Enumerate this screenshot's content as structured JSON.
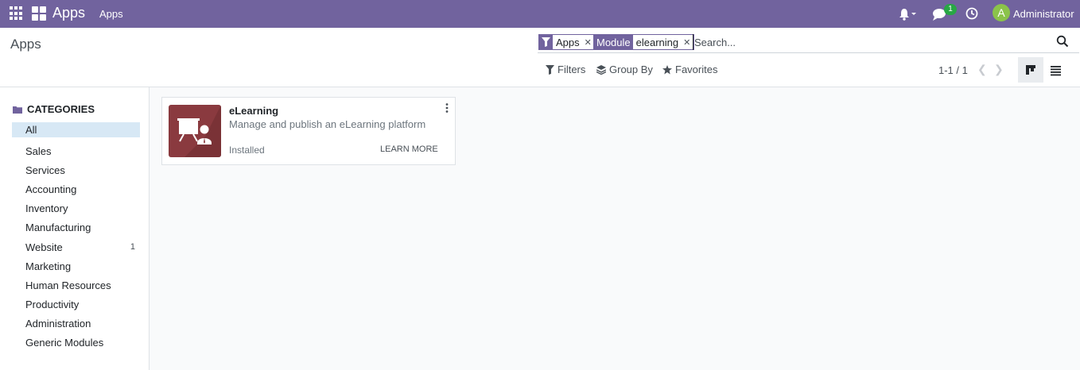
{
  "navbar": {
    "brand": "Apps",
    "menu": [
      "Apps"
    ],
    "chat_badge": "1",
    "avatar_letter": "A",
    "username": "Administrator"
  },
  "control_panel": {
    "breadcrumb": "Apps",
    "facets": [
      {
        "icon": "filter-icon",
        "label": "",
        "value": "Apps"
      },
      {
        "icon": "",
        "label": "Module",
        "value": "elearning"
      }
    ],
    "search_placeholder": "Search...",
    "filters_label": "Filters",
    "group_by_label": "Group By",
    "favorites_label": "Favorites",
    "pager": "1-1 / 1",
    "active_view": "kanban"
  },
  "sidebar": {
    "header": "CATEGORIES",
    "items": [
      {
        "label": "All",
        "count": "",
        "active": true
      },
      {
        "label": "Sales",
        "count": ""
      },
      {
        "label": "Services",
        "count": ""
      },
      {
        "label": "Accounting",
        "count": ""
      },
      {
        "label": "Inventory",
        "count": ""
      },
      {
        "label": "Manufacturing",
        "count": ""
      },
      {
        "label": "Website",
        "count": "1"
      },
      {
        "label": "Marketing",
        "count": ""
      },
      {
        "label": "Human Resources",
        "count": ""
      },
      {
        "label": "Productivity",
        "count": ""
      },
      {
        "label": "Administration",
        "count": ""
      },
      {
        "label": "Generic Modules",
        "count": ""
      }
    ]
  },
  "cards": [
    {
      "title": "eLearning",
      "description": "Manage and publish an eLearning platform",
      "status": "Installed",
      "action": "LEARN MORE",
      "icon": "elearning-icon"
    }
  ],
  "colors": {
    "navbar": "#71639e",
    "active_category": "#d7e8f5",
    "elearning_icon_bg": "#8a3a3f"
  }
}
